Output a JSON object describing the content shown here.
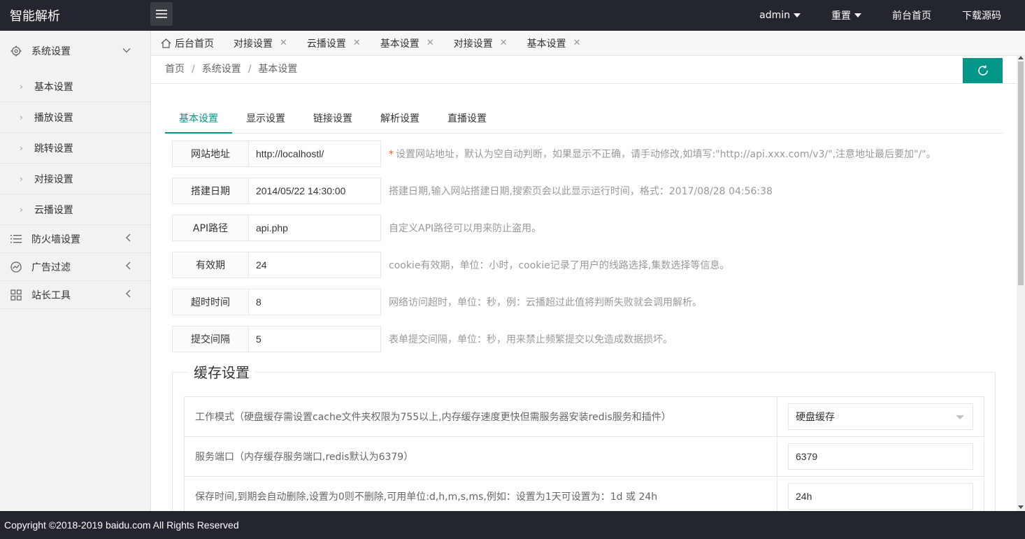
{
  "header": {
    "logo": "智能解析",
    "menu_toggle": "menu-icon",
    "right_items": [
      {
        "label": "admin",
        "dropdown": true
      },
      {
        "label": "重置",
        "dropdown": true
      },
      {
        "label": "前台首页",
        "dropdown": false
      },
      {
        "label": "下载源码",
        "dropdown": false
      }
    ]
  },
  "sidebar": {
    "system": {
      "label": "系统设置",
      "icon": "gear-icon"
    },
    "sub_items": [
      "基本设置",
      "播放设置",
      "跳转设置",
      "对接设置",
      "云播设置"
    ],
    "firewall": {
      "label": "防火墙设置",
      "icon": "list-icon"
    },
    "adfilter": {
      "label": "广告过滤",
      "icon": "chart-icon"
    },
    "tools": {
      "label": "站长工具",
      "icon": "grid-icon"
    }
  },
  "tabs": [
    {
      "label": "后台首页",
      "closable": false
    },
    {
      "label": "对接设置",
      "closable": true
    },
    {
      "label": "云播设置",
      "closable": true
    },
    {
      "label": "基本设置",
      "closable": true
    },
    {
      "label": "对接设置",
      "closable": true
    },
    {
      "label": "基本设置",
      "closable": true
    }
  ],
  "breadcrumb": [
    "首页",
    "系统设置",
    "基本设置"
  ],
  "content_tabs": [
    "基本设置",
    "显示设置",
    "链接设置",
    "解析设置",
    "直播设置"
  ],
  "form": {
    "site_url": {
      "label": "网站地址",
      "value": "http://localhostl/",
      "help": "设置网站地址，默认为空自动判断，如果显示不正确，请手动修改,如填写:\"http://api.xxx.com/v3/\",注意地址最后要加\"/\"。",
      "required_mark": "*"
    },
    "build_date": {
      "label": "搭建日期",
      "value": "2014/05/22 14:30:00",
      "help": "搭建日期,输入网站搭建日期,搜索页会以此显示运行时间，格式：2017/08/28 04:56:38"
    },
    "api_path": {
      "label": "API路径",
      "value": "api.php",
      "help": "自定义API路径可以用来防止盗用。"
    },
    "valid": {
      "label": "有效期",
      "value": "24",
      "help": "cookie有效期，单位：小时，cookie记录了用户的线路选择,集数选择等信息。"
    },
    "timeout": {
      "label": "超时时间",
      "value": "8",
      "help": "网络访问超时，单位：秒，例：云播超过此值将判断失败就会调用解析。"
    },
    "interval": {
      "label": "提交间隔",
      "value": "5",
      "help": "表单提交间隔，单位：秒，用来禁止频繁提交以免造成数据损坏。"
    }
  },
  "cache": {
    "legend": "缓存设置",
    "mode_label": "工作模式（硬盘缓存需设置cache文件夹权限为755以上,内存缓存速度更快但需服务器安装redis服务和插件）",
    "mode_value": "硬盘缓存",
    "port_label": "服务端口（内存缓存服务端口,redis默认为6379）",
    "port_value": "6379",
    "ttl_label": "保存时间,到期会自动删除,设置为0则不删除,可用单位:d,h,m,s,ms,例如：设置为1天可设置为：1d 或 24h",
    "ttl_value": "24h"
  },
  "footer": "Copyright ©2018-2019 baidu.com All Rights Reserved",
  "colors": {
    "accent": "#009688",
    "header_bg": "#23262e",
    "required": "#ff5722"
  }
}
